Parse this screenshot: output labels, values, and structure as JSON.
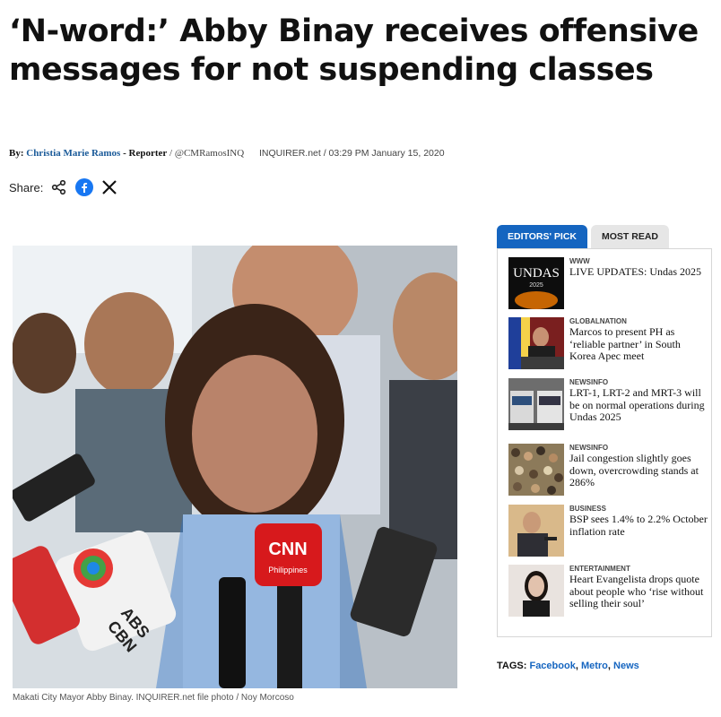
{
  "article": {
    "headline": "‘N-word:’ Abby Binay receives offensive messages for not suspending classes",
    "byline": {
      "by_label": "By:",
      "author": "Christia Marie Ramos",
      "role": "- Reporter",
      "handle": "/ @CMRamosINQ",
      "source": "INQUIRER.net",
      "datetime": "/ 03:29 PM January 15, 2020"
    },
    "share": {
      "label": "Share:",
      "icons": [
        "share-icon",
        "facebook-icon",
        "x-icon"
      ]
    },
    "photo_caption": "Makati City Mayor Abby Binay. INQUIRER.net file photo / Noy Morcoso",
    "photo_mic_labels": [
      "CNN",
      "Philippines",
      "ABS",
      "CBN"
    ]
  },
  "sidebar": {
    "tabs": [
      {
        "label": "EDITORS' PICK",
        "active": true
      },
      {
        "label": "MOST READ",
        "active": false
      }
    ],
    "items": [
      {
        "category": "WWW",
        "title": "LIVE UPDATES: Undas 2025",
        "thumb_text": "UNDAS",
        "thumb_sub": "2025"
      },
      {
        "category": "GLOBALNATION",
        "title": "Marcos to present PH as ‘reliable partner’ in South Korea Apec meet"
      },
      {
        "category": "NEWSINFO",
        "title": "LRT-1, LRT-2 and MRT-3 will be on normal operations during Undas 2025"
      },
      {
        "category": "NEWSINFO",
        "title": "Jail congestion slightly goes down, overcrowding stands at 286%"
      },
      {
        "category": "BUSINESS",
        "title": "BSP sees 1.4% to 2.2% October inflation rate"
      },
      {
        "category": "ENTERTAINMENT",
        "title": "Heart Evangelista drops quote about people who ‘rise without selling their soul’"
      }
    ]
  },
  "tags": {
    "label": "TAGS:",
    "items": [
      "Facebook",
      "Metro",
      "News"
    ]
  },
  "colors": {
    "link": "#1565c0",
    "active_tab": "#1565c0",
    "author": "#1a5a99"
  }
}
